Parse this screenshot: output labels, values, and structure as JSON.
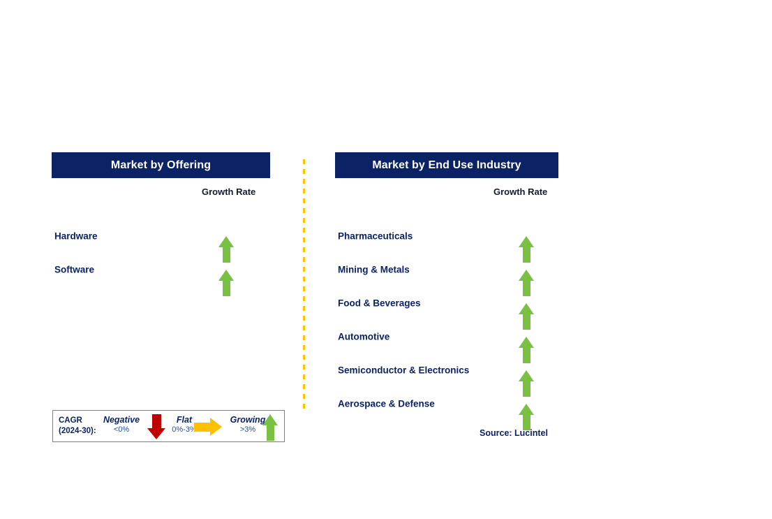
{
  "theme": {
    "header_bg": "#0b2265",
    "header_text": "#ffffff",
    "label_text": "#0b2265",
    "growing_arrow": "#7ac143",
    "flat_arrow": "#ffc000",
    "negative_arrow": "#bf0000",
    "divider": "#ffc20e",
    "legend_border": "#7f7f7f"
  },
  "panels": [
    {
      "title": "Market by Offering",
      "growth_rate_label": "Growth Rate",
      "rows": [
        {
          "label": "Hardware",
          "trend": "growing",
          "icon": "arrow-up-icon"
        },
        {
          "label": "Software",
          "trend": "growing",
          "icon": "arrow-up-icon"
        }
      ]
    },
    {
      "title": "Market by End Use Industry",
      "growth_rate_label": "Growth Rate",
      "rows": [
        {
          "label": "Pharmaceuticals",
          "trend": "growing",
          "icon": "arrow-up-icon"
        },
        {
          "label": "Mining & Metals",
          "trend": "growing",
          "icon": "arrow-up-icon"
        },
        {
          "label": "Food & Beverages",
          "trend": "growing",
          "icon": "arrow-up-icon"
        },
        {
          "label": "Automotive",
          "trend": "growing",
          "icon": "arrow-up-icon"
        },
        {
          "label": "Semiconductor & Electronics",
          "trend": "growing",
          "icon": "arrow-up-icon"
        },
        {
          "label": "Aerospace & Defense",
          "trend": "growing",
          "icon": "arrow-up-icon"
        }
      ]
    }
  ],
  "legend": {
    "cagr_line1": "CAGR",
    "cagr_line2": "(2024-30):",
    "items": [
      {
        "word": "Negative",
        "range": "<0%",
        "icon": "arrow-down-icon"
      },
      {
        "word": "Flat",
        "range": "0%-3%",
        "icon": "arrow-right-icon"
      },
      {
        "word": "Growing",
        "range": ">3%",
        "icon": "arrow-up-icon"
      }
    ]
  },
  "source": "Source: Lucintel"
}
